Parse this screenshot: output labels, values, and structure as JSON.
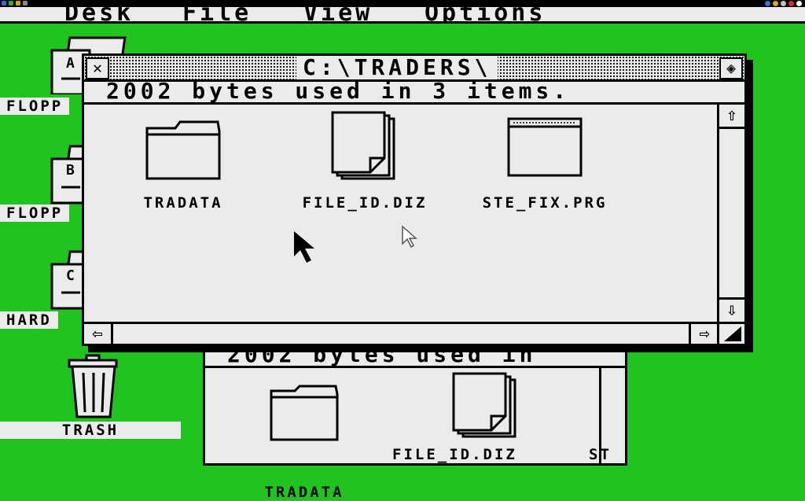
{
  "menubar": {
    "items": [
      "Desk",
      "File",
      "View",
      "Options"
    ]
  },
  "desktop": {
    "icons": [
      {
        "label": "FLOPP",
        "letter": "A"
      },
      {
        "label": "FLOPP",
        "letter": "B"
      },
      {
        "label": "HARD",
        "letter": "C"
      },
      {
        "label": "TRASH"
      }
    ]
  },
  "front_window": {
    "title": "C:\\TRADERS\\",
    "info": "2002 bytes used in 3 items.",
    "files": [
      {
        "label": "TRADATA",
        "icon": "folder-icon"
      },
      {
        "label": "FILE_ID.DIZ",
        "icon": "document-icon"
      },
      {
        "label": "STE_FIX.PRG",
        "icon": "program-icon"
      }
    ]
  },
  "back_window": {
    "info": "2002 bytes used in",
    "files": [
      {
        "label": "TRADATA"
      },
      {
        "label": "FILE_ID.DIZ"
      },
      {
        "label": "ST"
      }
    ]
  },
  "colors": {
    "desktop": "#1fc41f",
    "window": "#ebebeb",
    "ink": "#000000"
  }
}
